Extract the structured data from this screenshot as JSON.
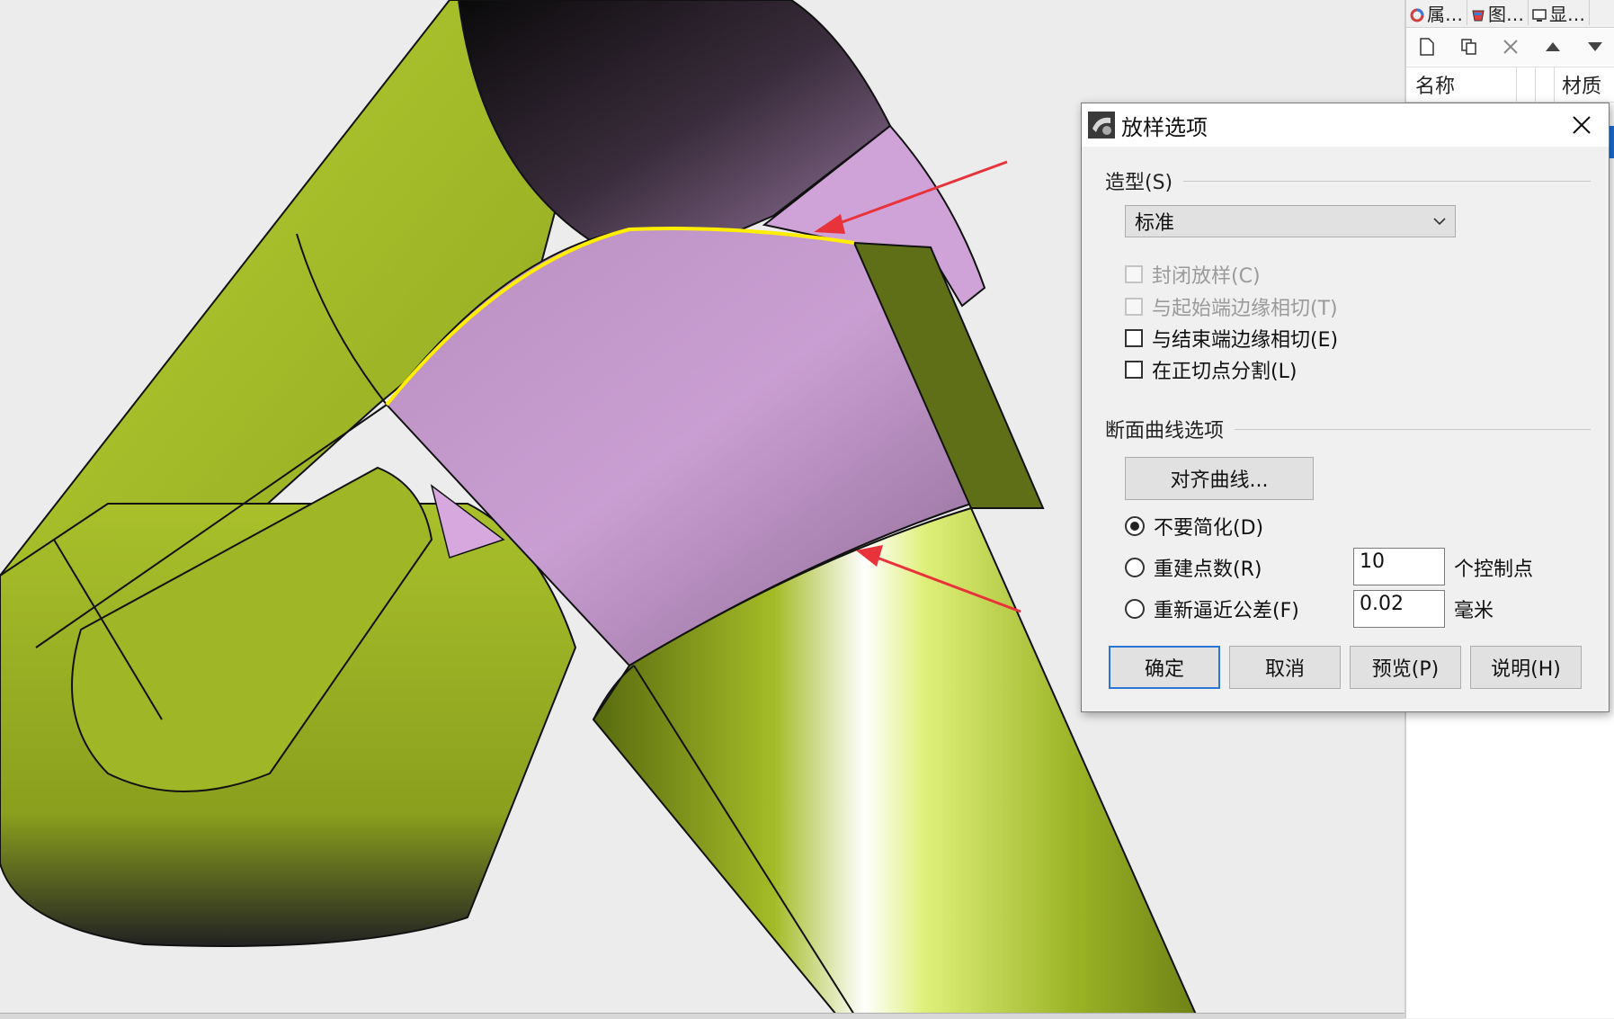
{
  "right_panel": {
    "tabs": [
      {
        "label": "属…",
        "icon": "color-wheel-icon"
      },
      {
        "label": "图…",
        "icon": "layers-icon"
      },
      {
        "label": "显…",
        "icon": "display-icon"
      }
    ],
    "toolbar": {
      "new_icon": "new-document-icon",
      "copy_icon": "copy-icon",
      "delete_icon": "delete-x-icon",
      "up_icon": "triangle-up-icon",
      "down_icon": "triangle-down-icon"
    },
    "header": {
      "name_col": "名称",
      "material_col": "材质"
    },
    "colors": {
      "selection": "#1e6fd6"
    }
  },
  "dialog": {
    "title": "放样选项",
    "style_section": "造型(S)",
    "style_value": "标准",
    "checkboxes": [
      {
        "label": "封闭放样(C)",
        "checked": false,
        "enabled": false
      },
      {
        "label": "与起始端边缘相切(T)",
        "checked": false,
        "enabled": false
      },
      {
        "label": "与结束端边缘相切(E)",
        "checked": false,
        "enabled": true
      },
      {
        "label": "在正切点分割(L)",
        "checked": false,
        "enabled": true
      }
    ],
    "section_curves": "断面曲线选项",
    "align_button": "对齐曲线...",
    "radios": [
      {
        "label": "不要简化(D)",
        "selected": true
      },
      {
        "label": "重建点数(R)",
        "selected": false
      },
      {
        "label": "重新逼近公差(F)",
        "selected": false
      }
    ],
    "rebuild_points": "10",
    "rebuild_unit": "个控制点",
    "refit_tolerance": "0.02",
    "refit_unit": "毫米",
    "buttons": {
      "ok": "确定",
      "cancel": "取消",
      "preview": "预览(P)",
      "help": "说明(H)"
    }
  },
  "viewport": {
    "colors": {
      "background": "#ececec",
      "green_surface": "#a6bd2a",
      "lofted_surface": "#c89bd0",
      "highlight_edge": "#ffee00",
      "annotation_arrow": "#e8333a"
    }
  }
}
